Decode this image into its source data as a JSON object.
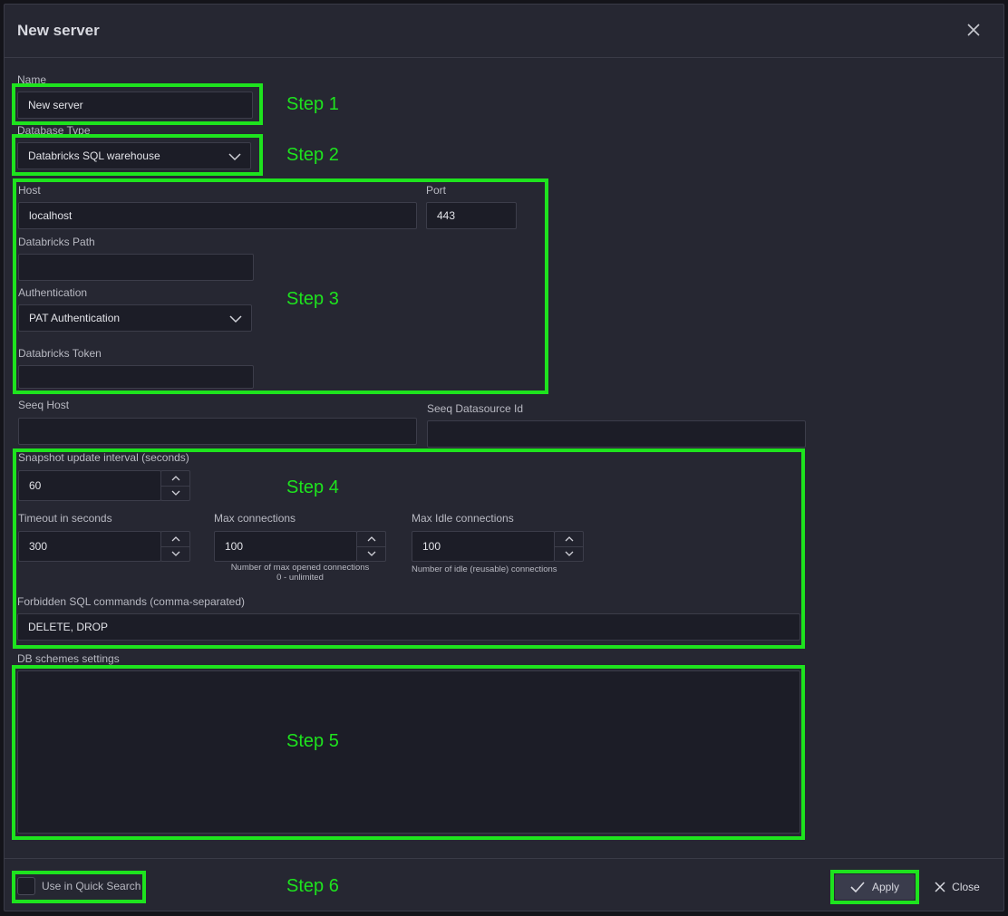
{
  "dialog": {
    "title": "New server",
    "close_icon": "close-icon"
  },
  "form": {
    "name_label": "Name",
    "name_value": "New server",
    "db_type_label": "Database Type",
    "db_type_value": "Databricks SQL warehouse",
    "host_label": "Host",
    "host_value": "localhost",
    "port_label": "Port",
    "port_value": "443",
    "path_label": "Databricks Path",
    "path_value": "",
    "auth_label": "Authentication",
    "auth_value": "PAT Authentication",
    "token_label": "Databricks Token",
    "token_value": "",
    "seeq_host_label": "Seeq Host",
    "seeq_host_value": "",
    "seeq_ds_label": "Seeq Datasource Id",
    "seeq_ds_value": "",
    "snapshot_label": "Snapshot update interval (seconds)",
    "snapshot_value": "60",
    "timeout_label": "Timeout in seconds",
    "timeout_value": "300",
    "max_conn_label": "Max connections",
    "max_conn_value": "100",
    "max_conn_hint_1": "Number of max opened connections",
    "max_conn_hint_2": "0 - unlimited",
    "max_idle_label": "Max Idle connections",
    "max_idle_value": "100",
    "max_idle_hint": "Number of idle (reusable) connections",
    "forbidden_label": "Forbidden SQL commands (comma-separated)",
    "forbidden_value": "DELETE, DROP",
    "schemes_label": "DB schemes settings"
  },
  "footer": {
    "quick_search_label": "Use in Quick Search",
    "apply_label": "Apply",
    "close_label": "Close"
  },
  "steps": {
    "s1": "Step 1",
    "s2": "Step 2",
    "s3": "Step 3",
    "s4": "Step 4",
    "s5": "Step 5",
    "s6": "Step 6"
  },
  "colors": {
    "highlight": "#1ee31e",
    "dialog_bg": "#262732",
    "field_bg": "#1c1d27"
  }
}
